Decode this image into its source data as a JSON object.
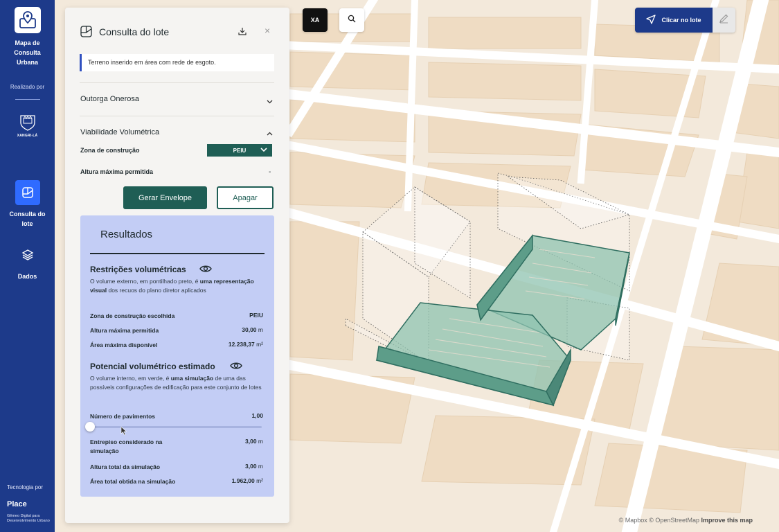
{
  "app": {
    "title": "Mapa de Consulta Urbana",
    "made_by_label": "Realizado por",
    "crest_text": "XANGRI-LÁ",
    "tech_label": "Tecnologia por",
    "tech_brand": "Place",
    "tech_subtitle": "Gêmeo Digital para Desenvolvimento Urbano"
  },
  "nav": {
    "items": [
      {
        "label": "Consulta do lote",
        "icon": "cube-outline-icon",
        "active": true
      },
      {
        "label": "Dados",
        "icon": "layers-icon",
        "active": false
      }
    ]
  },
  "toolbar": {
    "xa_label": "XA",
    "search_icon": "search-icon",
    "click_lot_label": "Clicar no lote",
    "click_lot_icon": "navigation-arrow-icon",
    "edit_icon": "pencil-icon"
  },
  "panel": {
    "title": "Consulta do lote",
    "notice": "Terreno inserido em área com rede de esgoto.",
    "outorga_title": "Outorga Onerosa",
    "viabilidade_title": "Viabilidade Volumétrica",
    "zona_label": "Zona de construção",
    "zona_value": "PEIU",
    "altura_label": "Altura máxima permitida",
    "altura_value": "-",
    "generate_button": "Gerar Envelope",
    "clear_button": "Apagar"
  },
  "results": {
    "title": "Resultados",
    "restricoes": {
      "title": "Restrições volumétricas",
      "desc_1": "O volume externo, em pontilhado preto, é ",
      "desc_bold": "uma representação visual",
      "desc_2": " dos recuos do plano diretor aplicados",
      "rows": [
        {
          "label": "Zona de construção escolhida",
          "value": "PEIU",
          "unit": ""
        },
        {
          "label": "Altura máxima permitida",
          "value": "30,00",
          "unit": " m"
        },
        {
          "label": "Área máxima disponível",
          "value": "12.238,37",
          "unit": " m²"
        }
      ]
    },
    "potencial": {
      "title": "Potencial volumétrico estimado",
      "desc_1": "O volume interno, em verde, é ",
      "desc_bold": "uma simulação",
      "desc_2": " de uma das possíveis configurações de edificação para este conjunto de lotes",
      "pavimentos_label": "Número de pavimentos",
      "pavimentos_value": "1,00",
      "slider_fraction": 0.0,
      "rows": [
        {
          "label": "Entrepiso considerado na simulação",
          "value": "3,00",
          "unit": " m"
        },
        {
          "label": "Altura total da simulação",
          "value": "3,00",
          "unit": " m"
        },
        {
          "label": "Área total obtida na simulação",
          "value": "1.962,00",
          "unit": " m²"
        }
      ]
    }
  },
  "map": {
    "attribution_1": "© Mapbox © OpenStreetMap ",
    "attribution_bold": "Improve this map"
  },
  "colors": {
    "rail": "#1d3a8a",
    "accent_blue": "#2f6bff",
    "primary_green": "#1f5e55",
    "volume_green": "#6fae9a",
    "results_bg": "#c3cdf5"
  }
}
